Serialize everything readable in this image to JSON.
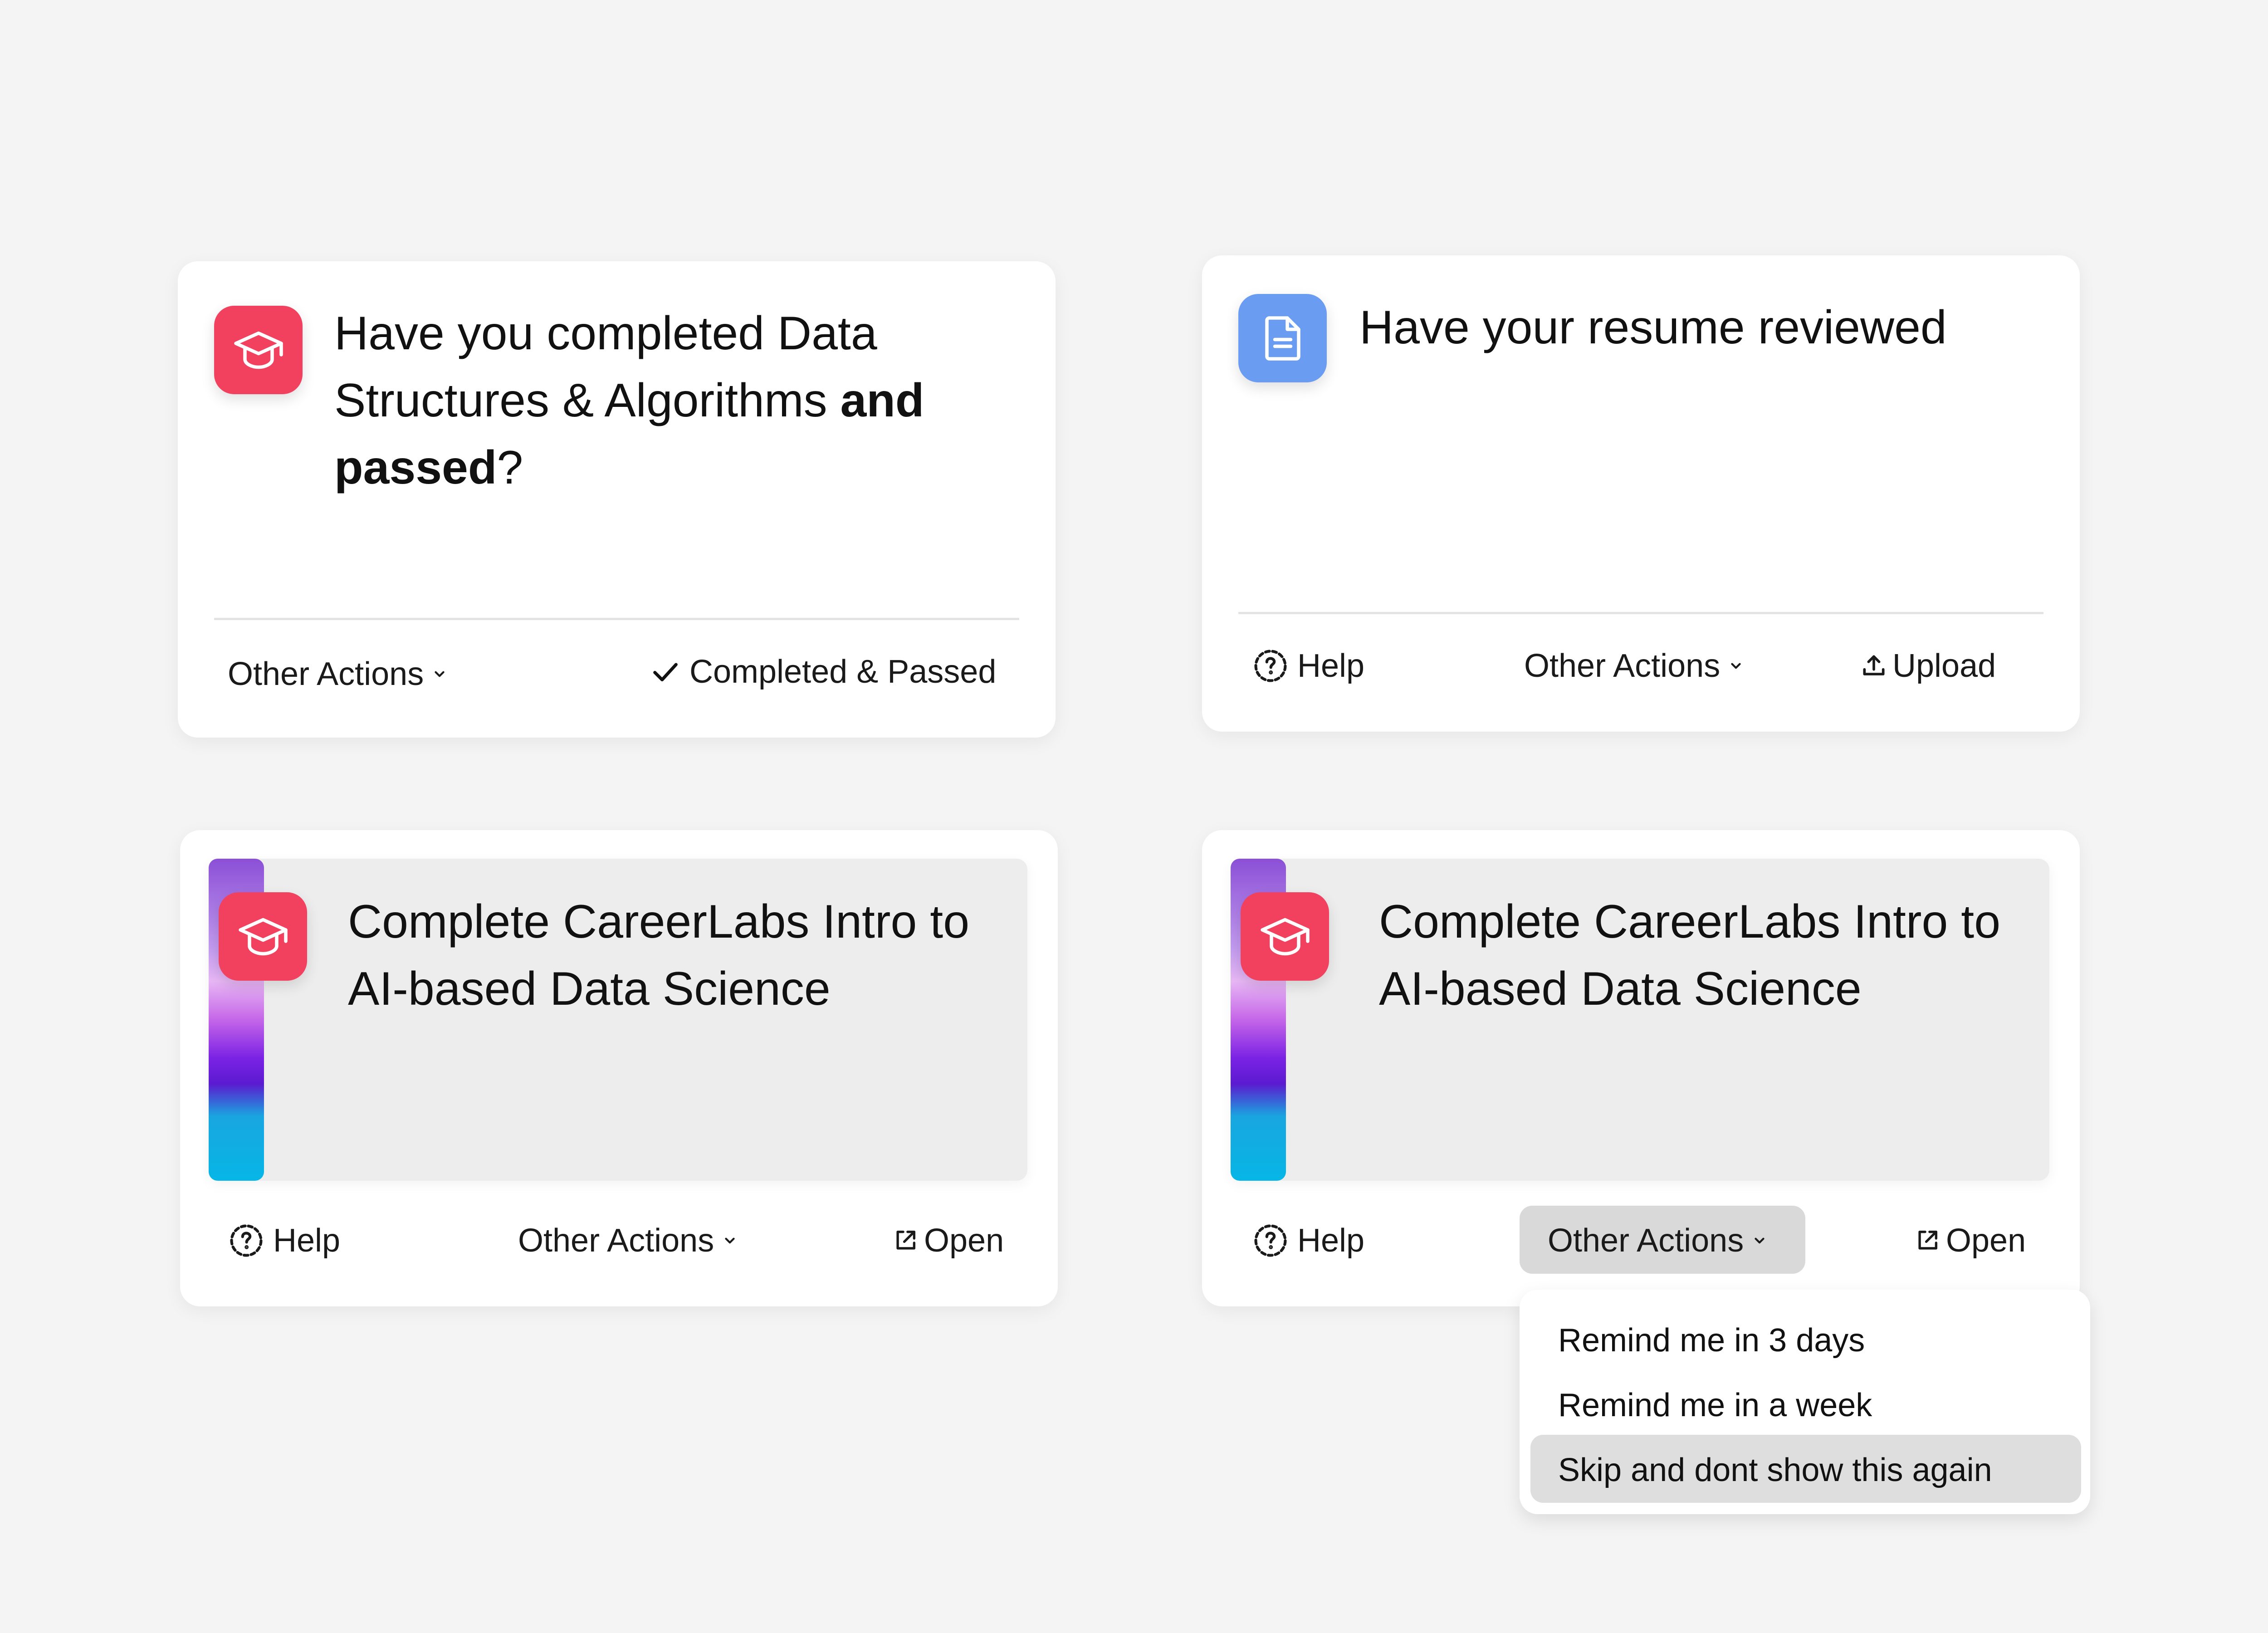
{
  "colors": {
    "page_background": "#f4f4f4",
    "card_background": "#ffffff",
    "brand_red": "#f2415f",
    "doc_blue": "#6a9cf2",
    "preview_background": "#ededed",
    "active_pill": "#d9d9d9"
  },
  "card1": {
    "icon": "graduation-cap-icon",
    "title_part1": "Have you completed Data Structures & Algorithms ",
    "title_bold1": "and",
    "title_bold2": "passed",
    "title_end": "?",
    "actions": {
      "other_actions": "Other Actions",
      "completed": "Completed & Passed"
    }
  },
  "card2": {
    "icon": "document-icon",
    "title": "Have your resume reviewed",
    "actions": {
      "help": "Help",
      "other_actions": "Other Actions",
      "upload": "Upload"
    }
  },
  "card3": {
    "icon": "graduation-cap-icon",
    "title": "Complete CareerLabs Intro to AI-based Data Science",
    "actions": {
      "help": "Help",
      "other_actions": "Other Actions",
      "open": "Open"
    }
  },
  "card4": {
    "icon": "graduation-cap-icon",
    "title": "Complete CareerLabs Intro to AI-based Data Science",
    "actions": {
      "help": "Help",
      "other_actions": "Other Actions",
      "open": "Open"
    },
    "dropdown": {
      "items": [
        "Remind me in 3 days",
        "Remind me in a week",
        "Skip and dont show this again"
      ],
      "highlighted_index": 2
    }
  }
}
